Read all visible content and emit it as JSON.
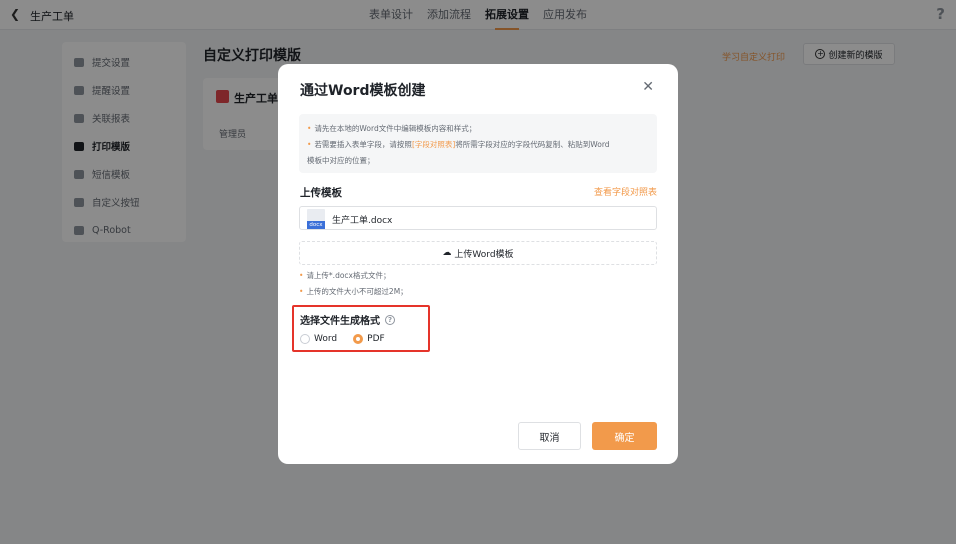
{
  "topbar": {
    "back_icon": "chevron-left-icon",
    "app_title": "生产工单",
    "steps": [
      "表单设计",
      "添加流程",
      "拓展设置",
      "应用发布"
    ],
    "help": "?"
  },
  "sidebar": {
    "items": [
      {
        "label": "提交设置",
        "icon": "send-icon"
      },
      {
        "label": "提醒设置",
        "icon": "bell-icon"
      },
      {
        "label": "关联报表",
        "icon": "report-icon"
      },
      {
        "label": "打印模版",
        "icon": "printer-icon"
      },
      {
        "label": "短信模板",
        "icon": "message-icon"
      },
      {
        "label": "自定义按钮",
        "icon": "button-icon"
      },
      {
        "label": "Q-Robot",
        "icon": "robot-icon"
      }
    ]
  },
  "content": {
    "title": "自定义打印模版",
    "learn_link": "学习自定义打印",
    "create_button": "创建新的模版",
    "card_title": "生产工单",
    "card_sub": "管理员"
  },
  "modal": {
    "title": "通过Word模板创建",
    "tips": {
      "line1": "请先在本地的Word文件中编辑模板内容和样式；",
      "line2_pre": "若需要插入表单字段，请按照",
      "line2_link": "[字段对照表]",
      "line2_post": "将所需字段对应的字段代码复制、粘贴到Word",
      "line3": "模板中对应的位置；"
    },
    "upload_section_title": "上传模板",
    "view_fields_link": "查看字段对照表",
    "file_tag": "docx",
    "file_name": "生产工单.docx",
    "upload_button": "上传Word模板",
    "upload_tips": [
      "请上传*.docx格式文件；",
      "上传的文件大小不可超过2M；"
    ],
    "format_title": "选择文件生成格式",
    "format_help": "?",
    "format_options": [
      {
        "label": "Word",
        "selected": false
      },
      {
        "label": "PDF",
        "selected": true
      }
    ],
    "cancel": "取消",
    "confirm": "确定"
  }
}
